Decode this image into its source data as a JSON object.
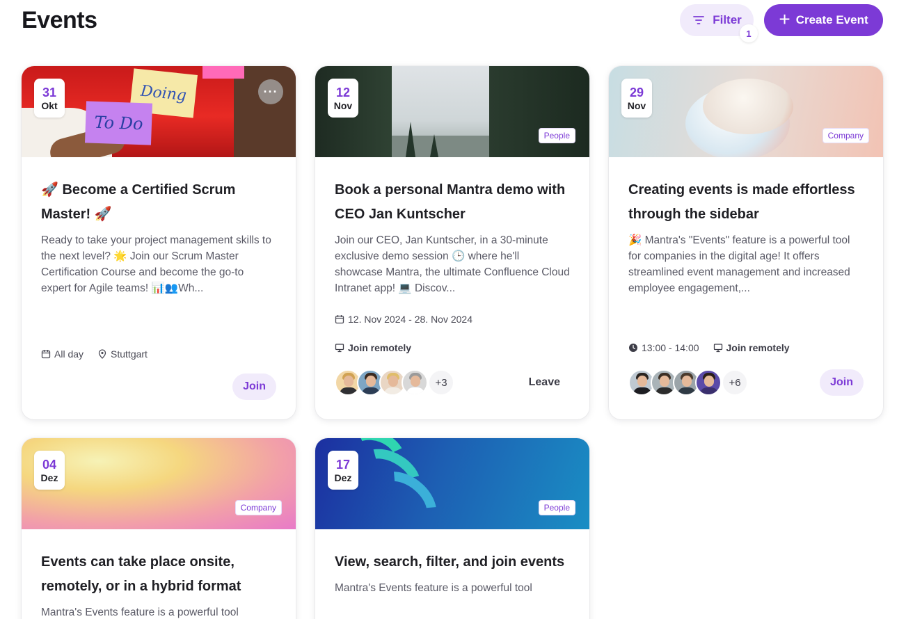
{
  "header": {
    "title": "Events",
    "filter_label": "Filter",
    "filter_count": "1",
    "create_label": "Create Event"
  },
  "colors": {
    "accent": "#7c3ad6",
    "accent_light": "#f1ebfb"
  },
  "events": [
    {
      "day": "31",
      "month": "Okt",
      "title": "🚀 Become a Certified Scrum Master! 🚀",
      "description": "Ready to take your project management skills to the next level? 🌟 Join our Scrum Master Certification Course and become the go-to expert for Agile teams! 📊👥Wh...",
      "time": "All day",
      "location": "Stuttgart",
      "action": "Join",
      "image_text": {
        "doing": "Doing",
        "todo": "To Do"
      }
    },
    {
      "day": "12",
      "month": "Nov",
      "tag": "People",
      "title": "Book a personal Mantra demo with CEO Jan Kuntscher",
      "description": "Join our CEO, Jan Kuntscher, in a 30-minute exclusive demo session 🕒 where he'll showcase Mantra, the ultimate Confluence Cloud Intranet app! 💻 Discov...",
      "date_range": "12. Nov 2024 - 28. Nov 2024",
      "remote": "Join remotely",
      "extra_attendees": "+3",
      "action": "Leave"
    },
    {
      "day": "29",
      "month": "Nov",
      "tag": "Company",
      "title": "Creating events is made effortless through the sidebar",
      "description": "🎉 Mantra's \"Events\" feature is a powerful tool for companies in the digital age! It offers streamlined event management and increased employee engagement,...",
      "time": "13:00 - 14:00",
      "remote": "Join remotely",
      "extra_attendees": "+6",
      "action": "Join"
    },
    {
      "day": "04",
      "month": "Dez",
      "tag": "Company",
      "title": "Events can take place onsite, remotely, or in a hybrid format",
      "description": "Mantra's Events feature is a powerful tool"
    },
    {
      "day": "17",
      "month": "Dez",
      "tag": "People",
      "title": "View, search, filter, and join events",
      "description": "Mantra's Events feature is a powerful tool"
    }
  ]
}
